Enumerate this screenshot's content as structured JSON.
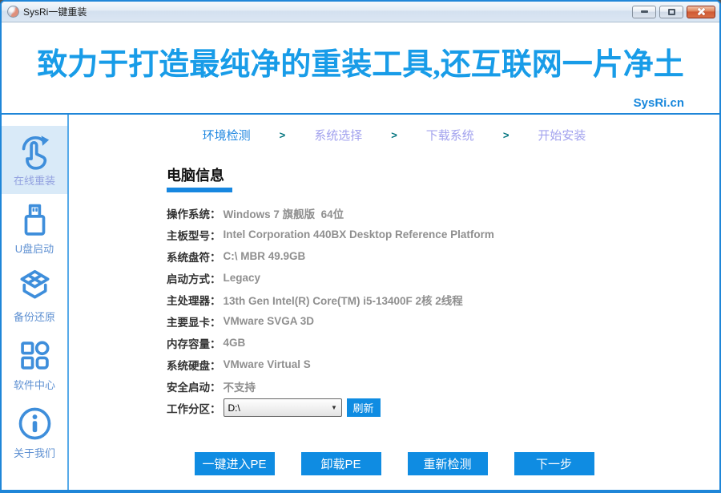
{
  "window": {
    "title": "SysRi一键重装",
    "controls": [
      "minimize",
      "maximize",
      "close"
    ]
  },
  "header": {
    "slogan": "致力于打造最纯净的重装工具,还互联网一片净土",
    "site": "SysRi.cn"
  },
  "sidebar": {
    "items": [
      {
        "label": "在线重装",
        "icon": "hand-refresh-icon",
        "active": true
      },
      {
        "label": "U盘启动",
        "icon": "usb-drive-icon",
        "active": false
      },
      {
        "label": "备份还原",
        "icon": "backup-box-icon",
        "active": false
      },
      {
        "label": "软件中心",
        "icon": "app-grid-icon",
        "active": false
      },
      {
        "label": "关于我们",
        "icon": "info-circle-icon",
        "active": false
      }
    ]
  },
  "steps": {
    "separator": ">",
    "active_index": 0,
    "items": [
      "环境检测",
      "系统选择",
      "下载系统",
      "开始安装"
    ]
  },
  "main": {
    "section_title": "电脑信息",
    "info_rows": [
      {
        "label": "操作系统：",
        "value": "Windows 7 旗舰版  64位"
      },
      {
        "label": "主板型号：",
        "value": "Intel Corporation 440BX Desktop Reference Platform"
      },
      {
        "label": "系统盘符：",
        "value": "C:\\ MBR 49.9GB"
      },
      {
        "label": "启动方式：",
        "value": "Legacy"
      },
      {
        "label": "主处理器：",
        "value": "13th Gen Intel(R) Core(TM) i5-13400F 2核 2线程"
      },
      {
        "label": "主要显卡：",
        "value": "VMware SVGA 3D"
      },
      {
        "label": "内存容量：",
        "value": "4GB"
      },
      {
        "label": "系统硬盘：",
        "value": "VMware Virtual S"
      },
      {
        "label": "安全启动：",
        "value": "不支持"
      }
    ],
    "partition": {
      "label": "工作分区：",
      "selected": "D:\\",
      "dropdown_arrow": "▼",
      "refresh_label": "刷新"
    },
    "buttons": [
      "一键进入PE",
      "卸载PE",
      "重新检测",
      "下一步"
    ]
  },
  "colors": {
    "accent_blue": "#0f8ce2",
    "header_text_blue": "#189ce8",
    "border_blue": "#1f86d8",
    "step_active": "#1f87e0",
    "step_inactive": "#a2a2ee",
    "step_separator": "#00747e",
    "sidebar_active_bg": "#d9eaf8",
    "label_text": "#333333",
    "value_text": "#8f8f8f"
  }
}
